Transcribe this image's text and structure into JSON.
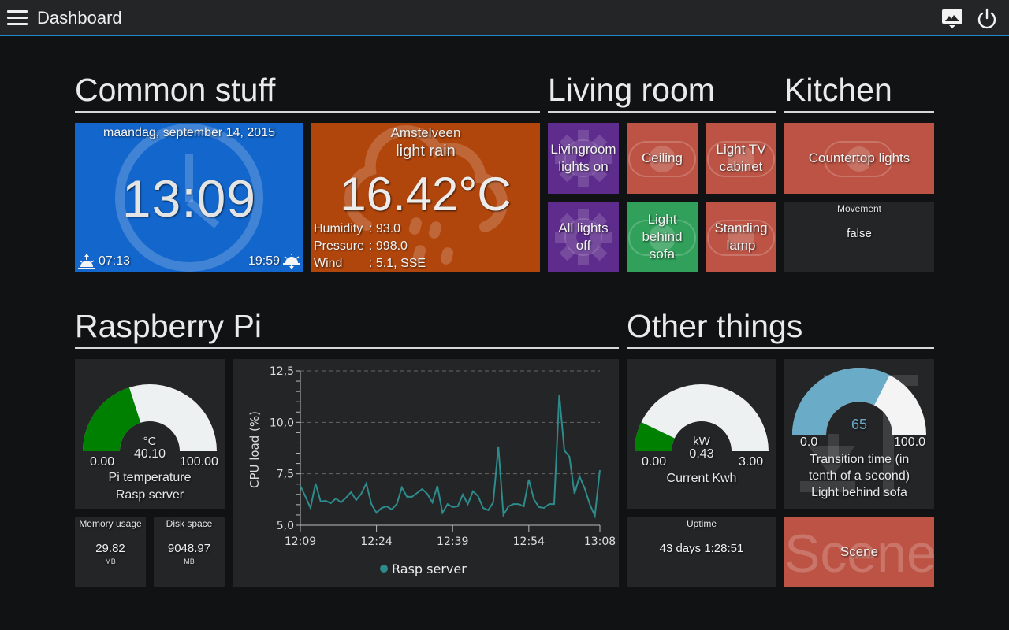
{
  "topbar": {
    "title": "Dashboard",
    "menu_icon": "hamburger-menu-icon",
    "photo_icon": "photo-frame-icon",
    "power_icon": "power-icon",
    "accent_color": "#1e88c8"
  },
  "sections": {
    "common": "Common stuff",
    "living": "Living room",
    "kitchen": "Kitchen",
    "raspberry": "Raspberry Pi",
    "other": "Other things"
  },
  "clock": {
    "date": "maandag, september 14, 2015",
    "time": "13:09",
    "sunrise": "07:13",
    "sunset": "19:59"
  },
  "weather": {
    "city": "Amstelveen",
    "description": "light rain",
    "temperature": "16.42°C",
    "humidity_label": "Humidity",
    "humidity": ": 93.0",
    "pressure_label": "Pressure",
    "pressure": ": 998.0",
    "wind_label": "Wind",
    "wind": ": 5.1, SSE"
  },
  "living_room": {
    "scene_on": "Livingroom lights on",
    "ceiling": "Ceiling",
    "tv_cabinet": "Light TV cabinet",
    "all_off": "All lights off",
    "behind_sofa": "Light behind sofa",
    "standing_lamp": "Standing lamp"
  },
  "kitchen": {
    "countertop": "Countertop lights",
    "movement_title": "Movement",
    "movement_value": "false"
  },
  "raspberry": {
    "temp_gauge": {
      "unit": "°C",
      "value": "40.10",
      "value_num": 40.1,
      "min": "0.00",
      "max": "100.00",
      "min_num": 0,
      "max_num": 100,
      "label1": "Pi temperature",
      "label2": "Rasp server",
      "fill_color": "#008000"
    },
    "memory": {
      "title": "Memory usage",
      "value": "29.82",
      "unit": "MB"
    },
    "disk": {
      "title": "Disk space",
      "value": "9048.97",
      "unit": "MB"
    }
  },
  "chart_data": {
    "type": "line",
    "title": "",
    "xlabel": "",
    "ylabel": "CPU load (%)",
    "ylim": [
      5.0,
      12.5
    ],
    "yticks": [
      "5,0",
      "7,5",
      "10,0",
      "12,5"
    ],
    "ytick_values": [
      5.0,
      7.5,
      10.0,
      12.5
    ],
    "xticks": [
      "12:09",
      "12:24",
      "12:39",
      "12:54",
      "13:08"
    ],
    "xtick_minutes": [
      0,
      15,
      30,
      45,
      59
    ],
    "grid": "horizontal dashed",
    "legend_position": "bottom",
    "series": [
      {
        "name": "Rasp server",
        "color": "#2e8b8b",
        "x_minutes": [
          0,
          1,
          2,
          3,
          4,
          5,
          6,
          7,
          8,
          9,
          10,
          11,
          12,
          13,
          14,
          15,
          16,
          17,
          18,
          19,
          20,
          21,
          22,
          23,
          24,
          25,
          26,
          27,
          28,
          29,
          30,
          31,
          32,
          33,
          34,
          35,
          36,
          37,
          38,
          39,
          40,
          41,
          42,
          43,
          44,
          45,
          46,
          47,
          48,
          49,
          50,
          51,
          52,
          53,
          54,
          55,
          56,
          57,
          58
        ],
        "values": [
          6.91,
          6.4,
          5.84,
          7.03,
          6.15,
          6.19,
          6.07,
          6.3,
          6.11,
          6.34,
          6.61,
          6.22,
          6.53,
          7.03,
          6.03,
          5.61,
          5.84,
          5.92,
          5.77,
          6.03,
          6.84,
          6.38,
          6.38,
          6.57,
          6.76,
          6.53,
          6.11,
          6.91,
          5.61,
          6.03,
          5.88,
          5.92,
          6.49,
          6.03,
          6.65,
          6.42,
          5.84,
          5.73,
          6.11,
          8.83,
          5.5,
          5.92,
          6.03,
          6.03,
          5.92,
          7.22,
          6.26,
          5.88,
          5.84,
          6.03,
          6.03,
          11.35,
          8.64,
          8.33,
          6.53,
          7.37,
          6.8,
          6.03,
          5.46
        ]
      }
    ]
  },
  "chart_last_value": 7.68,
  "other": {
    "kwh_gauge": {
      "unit": "kW",
      "value": "0.43",
      "value_num": 0.43,
      "min": "0.00",
      "max": "3.00",
      "min_num": 0,
      "max_num": 3,
      "label": "Current Kwh",
      "fill_color": "#008000"
    },
    "transition_gauge": {
      "value": "65",
      "value_num": 65,
      "min": "0.0",
      "max": "100.0",
      "min_num": 0,
      "max_num": 100,
      "label1": "Transition time (in",
      "label2": "tenth of a second)",
      "label3": "Light behind sofa",
      "fill_color": "#6aabc8"
    },
    "uptime": {
      "title": "Uptime",
      "value": "43 days 1:28:51"
    },
    "scene": {
      "label": "Scene",
      "bg_text": "Scene"
    }
  }
}
